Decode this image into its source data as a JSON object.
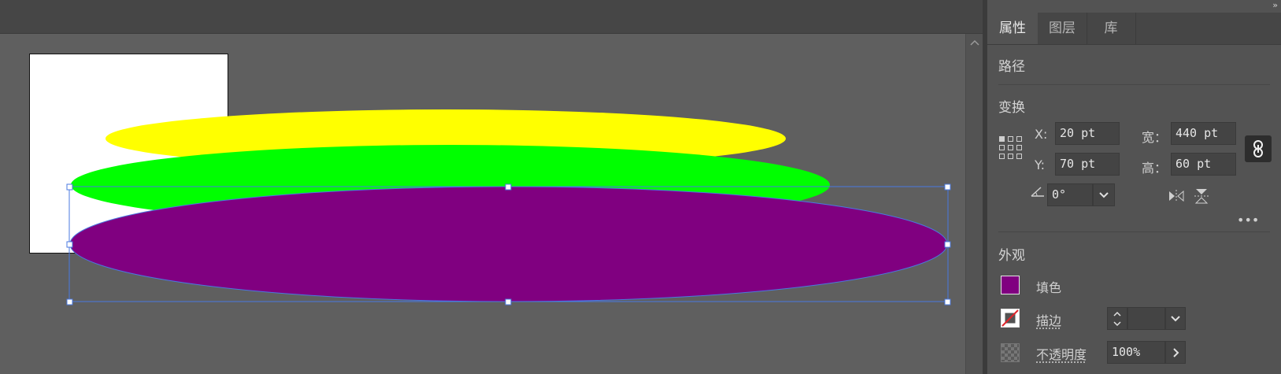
{
  "canvas": {
    "shapes": [
      {
        "name": "yellow-ellipse",
        "fill": "#ffff00"
      },
      {
        "name": "green-ellipse",
        "fill": "#00ff00"
      },
      {
        "name": "purple-ellipse",
        "fill": "#800080",
        "selected": true
      }
    ],
    "selection_color": "#4a78e0"
  },
  "panel": {
    "collapse_glyph": "››",
    "tabs": [
      {
        "label": "属性",
        "active": true
      },
      {
        "label": "图层",
        "active": false
      },
      {
        "label": "库",
        "active": false
      }
    ],
    "object_type": "路径",
    "transform": {
      "title": "变换",
      "x_label": "X:",
      "x_value": "20 pt",
      "y_label": "Y:",
      "y_value": "70 pt",
      "w_label": "宽：",
      "w_value": "440 pt",
      "h_label": "高：",
      "h_value": "60 pt",
      "angle_value": "0°",
      "more": "•••"
    },
    "appearance": {
      "title": "外观",
      "fill_label": "填色",
      "fill_color": "#800080",
      "stroke_label": "描边",
      "stroke_value": "",
      "opacity_label": "不透明度",
      "opacity_value": "100%"
    }
  },
  "icons": {
    "reference_point": "reference-point-grid-icon",
    "constrain": "link-chain-icon",
    "angle": "angle-icon",
    "flip_h": "flip-horizontal-icon",
    "flip_v": "flip-vertical-icon",
    "scroll_up": "chevron-up-icon",
    "dropdown": "chevron-down-icon",
    "opacity_more": "chevron-right-icon"
  }
}
